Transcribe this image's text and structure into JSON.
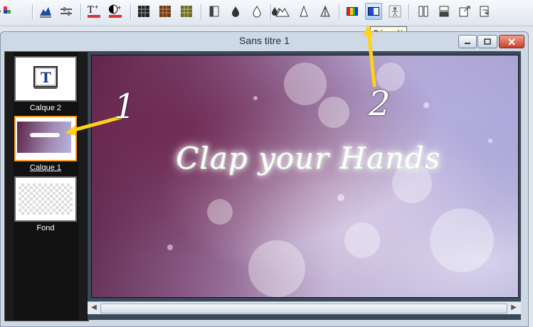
{
  "toolbar": {
    "tooltip": "Dégradé",
    "buttons": [
      "channel-icon",
      "histogram-icon",
      "sliders-icon",
      "text-auto-icon",
      "text-contrast-auto-icon",
      "grid-dark-icon",
      "grid-brown-icon",
      "grid-olive-icon",
      "mask-layer-icon",
      "drop-icon",
      "drop-outline-icon",
      "drop-double-icon",
      "mountain-icon",
      "cone-icon",
      "pyramid-icon",
      "color-palette-icon",
      "gradient-icon",
      "figure-icon",
      "book-icon",
      "layers-icon",
      "export-icon",
      "import-icon"
    ],
    "active": "gradient-icon",
    "accent": "#7aa7d8"
  },
  "window": {
    "title": "Sans titre 1",
    "close_color": "#c7412c"
  },
  "layers": [
    {
      "name": "Calque 2",
      "type": "text"
    },
    {
      "name": "Calque 1",
      "type": "image",
      "selected": true
    },
    {
      "name": "Fond",
      "type": "transparent"
    }
  ],
  "canvas": {
    "text": "Clap your Hands"
  },
  "annotations": {
    "label1": "1",
    "label2": "2",
    "arrow_color": "#ffd21a"
  }
}
